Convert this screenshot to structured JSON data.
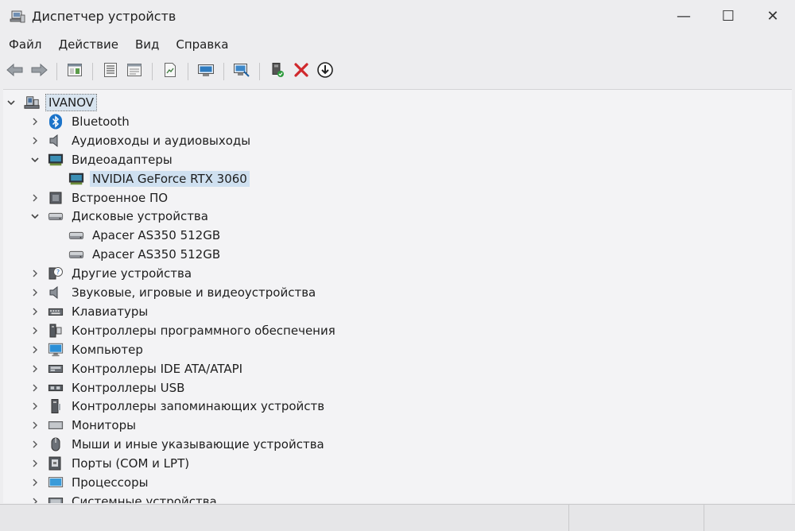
{
  "window": {
    "title": "Диспетчер устройств",
    "controls": {
      "minimize": "—",
      "maximize": "☐",
      "close": "✕"
    }
  },
  "menu": [
    {
      "label": "Файл"
    },
    {
      "label": "Действие"
    },
    {
      "label": "Вид"
    },
    {
      "label": "Справка"
    }
  ],
  "toolbar": [
    {
      "icon": "back-arrow-icon"
    },
    {
      "icon": "forward-arrow-icon"
    },
    {
      "icon": "show-hide-console-tree-icon"
    },
    {
      "icon": "properties-icon"
    },
    {
      "icon": "help-pane-icon"
    },
    {
      "icon": "export-icon"
    },
    {
      "icon": "scan-hardware-icon"
    },
    {
      "icon": "update-driver-icon"
    },
    {
      "icon": "enable-device-icon"
    },
    {
      "icon": "uninstall-device-icon"
    },
    {
      "icon": "download-icon"
    }
  ],
  "tree": {
    "root": {
      "label": "IVANOV",
      "icon": "computer-root-icon",
      "expanded": true
    },
    "items": [
      {
        "label": "Bluetooth",
        "icon": "bluetooth-icon",
        "expanded": false,
        "level": 1
      },
      {
        "label": "Аудиовходы и аудиовыходы",
        "icon": "speaker-icon",
        "expanded": false,
        "level": 1
      },
      {
        "label": "Видеоадаптеры",
        "icon": "display-adapter-icon",
        "expanded": true,
        "level": 1
      },
      {
        "label": "NVIDIA GeForce RTX 3060",
        "icon": "display-adapter-icon",
        "level": 2,
        "selected": true
      },
      {
        "label": "Встроенное ПО",
        "icon": "firmware-icon",
        "expanded": false,
        "level": 1
      },
      {
        "label": "Дисковые устройства",
        "icon": "disk-drive-icon",
        "expanded": true,
        "level": 1
      },
      {
        "label": "Apacer AS350 512GB",
        "icon": "disk-drive-icon",
        "level": 2
      },
      {
        "label": "Apacer AS350 512GB",
        "icon": "disk-drive-icon",
        "level": 2
      },
      {
        "label": "Другие устройства",
        "icon": "other-devices-icon",
        "expanded": false,
        "level": 1
      },
      {
        "label": "Звуковые, игровые и видеоустройства",
        "icon": "speaker-icon",
        "expanded": false,
        "level": 1
      },
      {
        "label": "Клавиатуры",
        "icon": "keyboard-icon",
        "expanded": false,
        "level": 1
      },
      {
        "label": "Контроллеры программного обеспечения",
        "icon": "software-controller-icon",
        "expanded": false,
        "level": 1
      },
      {
        "label": "Компьютер",
        "icon": "monitor-icon",
        "expanded": false,
        "level": 1
      },
      {
        "label": "Контроллеры IDE ATA/ATAPI",
        "icon": "ide-controller-icon",
        "expanded": false,
        "level": 1
      },
      {
        "label": "Контроллеры USB",
        "icon": "usb-controller-icon",
        "expanded": false,
        "level": 1
      },
      {
        "label": "Контроллеры запоминающих устройств",
        "icon": "storage-controller-icon",
        "expanded": false,
        "level": 1
      },
      {
        "label": "Мониторы",
        "icon": "monitor-bar-icon",
        "expanded": false,
        "level": 1
      },
      {
        "label": "Мыши и иные указывающие устройства",
        "icon": "mouse-icon",
        "expanded": false,
        "level": 1
      },
      {
        "label": "Порты (COM и LPT)",
        "icon": "port-icon",
        "expanded": false,
        "level": 1
      },
      {
        "label": "Процессоры",
        "icon": "processor-icon",
        "expanded": false,
        "level": 1
      },
      {
        "label": "Системные устройства",
        "icon": "system-devices-icon",
        "expanded": false,
        "level": 1
      }
    ]
  },
  "colors": {
    "selection": "#cfe0f0",
    "accent": "#1f6fb5"
  }
}
